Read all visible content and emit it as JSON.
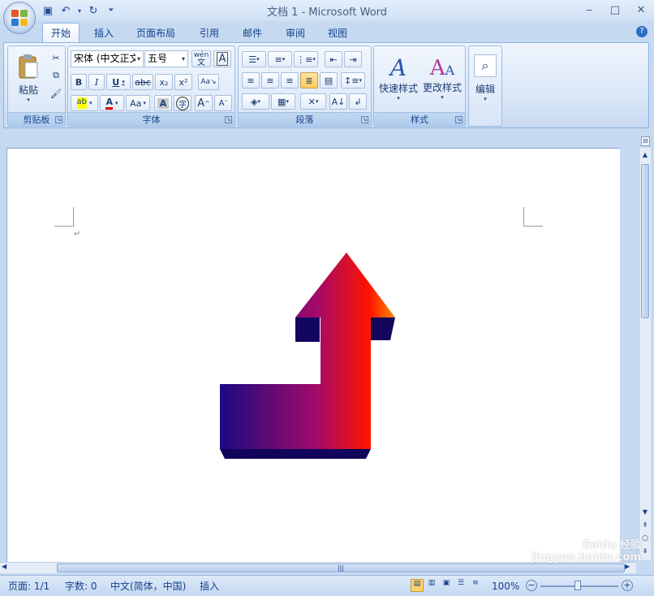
{
  "window": {
    "title": "文档 1 - Microsoft Word"
  },
  "tabs": [
    "开始",
    "插入",
    "页面布局",
    "引用",
    "邮件",
    "审阅",
    "视图"
  ],
  "ribbon": {
    "clipboard": {
      "label": "剪贴板",
      "paste_label": "粘贴"
    },
    "font": {
      "label": "字体",
      "font_name": "宋体 (中文正文)",
      "font_size": "五号",
      "phonetic": "wén",
      "bold": "B",
      "italic": "I",
      "underline": "U",
      "strike": "abc",
      "sub": "x₂",
      "sup": "x²",
      "grow": "A",
      "shrink": "A",
      "case": "Aa",
      "color_a": "A",
      "char_border": "A",
      "enclose": "字"
    },
    "paragraph": {
      "label": "段落"
    },
    "styles": {
      "label": "样式",
      "quick_styles": "快速样式",
      "change_styles": "更改样式"
    },
    "editing": {
      "label": "编辑"
    }
  },
  "status": {
    "page": "页面: 1/1",
    "words": "字数: 0",
    "language": "中文(简体，中国)",
    "insert_mode": "插入",
    "zoom": "100%"
  },
  "watermark": "Baidu 经验 jingyan.baidu.com",
  "colors": {
    "ribbon": "#dbe7f7",
    "accent": "#15428b",
    "arrow_start": "#1a0a80",
    "arrow_end": "#ff1200"
  }
}
